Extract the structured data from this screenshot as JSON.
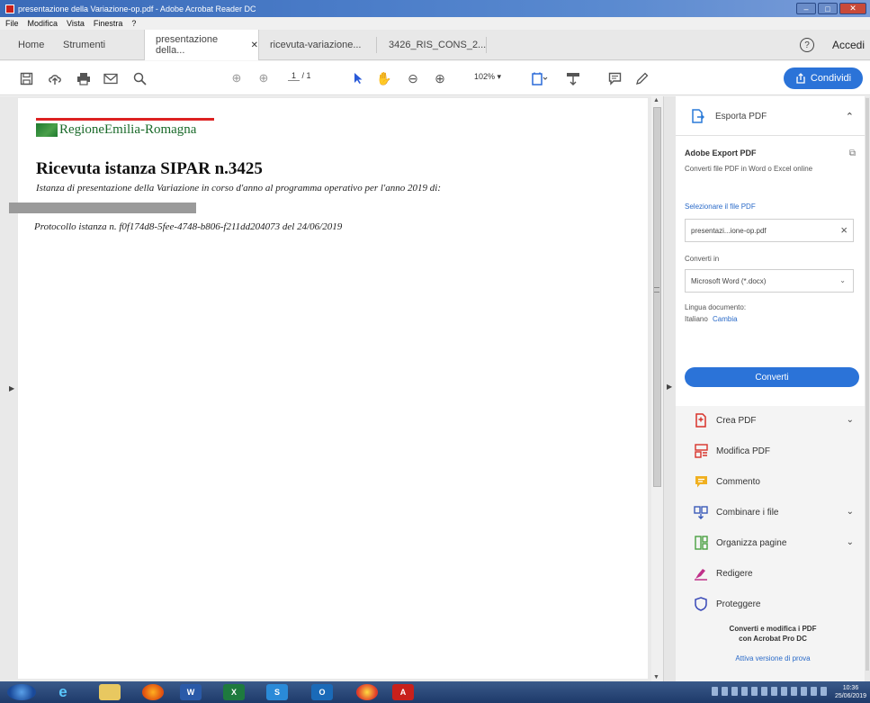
{
  "window": {
    "title": "presentazione della Variazione-op.pdf - Adobe Acrobat Reader DC"
  },
  "menubar": [
    "File",
    "Modifica",
    "Vista",
    "Finestra",
    "?"
  ],
  "tabs": {
    "home": "Home",
    "tools": "Strumenti",
    "doc1": "presentazione della...",
    "doc2": "ricevuta-variazione...",
    "doc3": "3426_RIS_CONS_2...",
    "help_icon": "help-circle-icon",
    "signin": "Accedi"
  },
  "toolbar": {
    "page_current": "1",
    "page_total": "/ 1",
    "zoom": "102%",
    "share_label": "Condividi"
  },
  "document": {
    "logo_text": "RegioneEmilia-Romagna",
    "title": "Ricevuta istanza SIPAR n.3425",
    "subtitle": "Istanza di presentazione della Variazione in corso d'anno al programma operativo per l'anno 2019 di:",
    "protocol": "Protocollo istanza n. f0f174d8-5fee-4748-b806-f211dd204073 del 24/06/2019"
  },
  "right_pane": {
    "export_header": "Esporta PDF",
    "service_title": "Adobe Export PDF",
    "service_desc": "Converti file PDF in Word o Excel online",
    "select_file_label": "Selezionare il file PDF",
    "file_name": "presentazi...ione-op.pdf",
    "convert_to_label": "Converti in",
    "convert_to_value": "Microsoft Word (*.docx)",
    "lang_label": "Lingua documento:",
    "lang_value": "Italiano",
    "lang_change": "Cambia",
    "convert_button": "Converti",
    "tools": [
      {
        "label": "Crea PDF",
        "icon": "create-pdf-icon",
        "color": "#d8322a",
        "chevron": "⌄"
      },
      {
        "label": "Modifica PDF",
        "icon": "edit-pdf-icon",
        "color": "#d8322a",
        "chevron": ""
      },
      {
        "label": "Commento",
        "icon": "comment-icon",
        "color": "#f0b020",
        "chevron": ""
      },
      {
        "label": "Combinare i file",
        "icon": "combine-files-icon",
        "color": "#3a5ab8",
        "chevron": "⌄"
      },
      {
        "label": "Organizza pagine",
        "icon": "organize-pages-icon",
        "color": "#4aa040",
        "chevron": "⌄"
      },
      {
        "label": "Redigere",
        "icon": "redact-icon",
        "color": "#c0308a",
        "chevron": ""
      },
      {
        "label": "Proteggere",
        "icon": "protect-icon",
        "color": "#3a4ab8",
        "chevron": ""
      }
    ],
    "promo_line1": "Converti e modifica i PDF",
    "promo_line2": "con Acrobat Pro DC",
    "promo_trial": "Attiva versione di prova"
  },
  "taskbar": {
    "time": "10:36",
    "date": "25/06/2019"
  }
}
